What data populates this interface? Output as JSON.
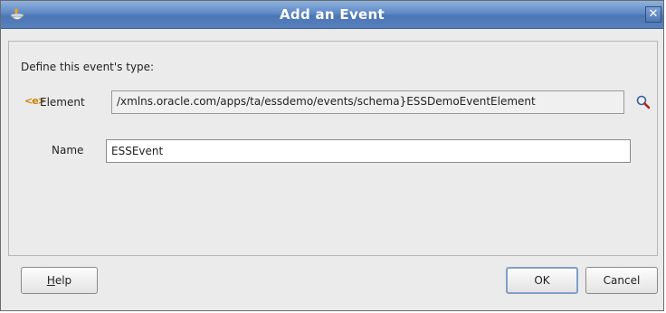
{
  "window": {
    "title": "Add an Event",
    "close_glyph": "✕",
    "icon": "oracle-jdev-icon"
  },
  "form": {
    "define_label": "Define this event's type:",
    "element_icon_text": "<e>",
    "element_label": "Element",
    "element_value": "/xmlns.oracle.com/apps/ta/essdemo/events/schema}ESSDemoEventElement",
    "name_label": "Name",
    "name_value": "ESSEvent"
  },
  "buttons": {
    "help_mnemonic": "H",
    "help_rest": "elp",
    "ok": "OK",
    "cancel": "Cancel"
  },
  "colors": {
    "titlebar": "#5f89c5",
    "dialog_bg": "#ebebeb",
    "element_icon": "#c48400"
  }
}
